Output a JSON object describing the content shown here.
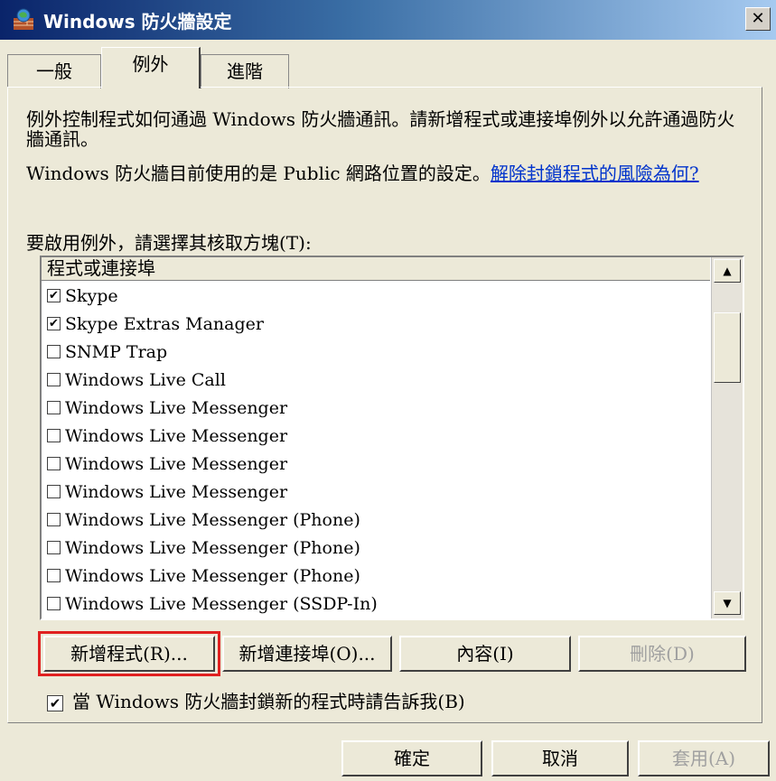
{
  "window": {
    "title": "Windows 防火牆設定",
    "close_label": "✕"
  },
  "tabs": [
    {
      "label": "一般"
    },
    {
      "label": "例外"
    },
    {
      "label": "進階"
    }
  ],
  "exceptions": {
    "description": "例外控制程式如何通過 Windows 防火牆通訊。請新增程式或連接埠例外以允許通過防火牆通訊。",
    "location_text": "Windows 防火牆目前使用的是 Public 網路位置的設定。",
    "location_link": "解除封鎖程式的風險為何?",
    "list_label": "要啟用例外，請選擇其核取方塊(T):",
    "list_header": "程式或連接埠",
    "items": [
      {
        "label": "Skype",
        "checked": true,
        "mark": "✔"
      },
      {
        "label": "Skype Extras Manager",
        "checked": true,
        "mark": "✔"
      },
      {
        "label": "SNMP Trap",
        "checked": false,
        "mark": ""
      },
      {
        "label": "Windows Live Call",
        "checked": false,
        "mark": ""
      },
      {
        "label": "Windows Live Messenger",
        "checked": false,
        "mark": ""
      },
      {
        "label": "Windows Live Messenger",
        "checked": false,
        "mark": ""
      },
      {
        "label": "Windows Live Messenger",
        "checked": false,
        "mark": ""
      },
      {
        "label": "Windows Live Messenger",
        "checked": false,
        "mark": ""
      },
      {
        "label": "Windows Live Messenger (Phone)",
        "checked": false,
        "mark": ""
      },
      {
        "label": "Windows Live Messenger (Phone)",
        "checked": false,
        "mark": ""
      },
      {
        "label": "Windows Live Messenger (Phone)",
        "checked": false,
        "mark": ""
      },
      {
        "label": "Windows Live Messenger (SSDP-In)",
        "checked": false,
        "mark": ""
      }
    ],
    "scroll_up": "▲",
    "scroll_down": "▼",
    "buttons": {
      "add_program": "新增程式(R)...",
      "add_port": "新增連接埠(O)...",
      "properties": "內容(I)",
      "delete": "刪除(D)"
    },
    "notify_label": "當 Windows 防火牆封鎖新的程式時請告訴我(B)",
    "notify_checked": true,
    "notify_mark": "✔"
  },
  "footer": {
    "ok": "確定",
    "cancel": "取消",
    "apply": "套用(A)"
  },
  "colors": {
    "title_gradient_start": "#0a246a",
    "link": "#0033cc",
    "highlight": "#e02020",
    "face": "#ece9d8"
  }
}
